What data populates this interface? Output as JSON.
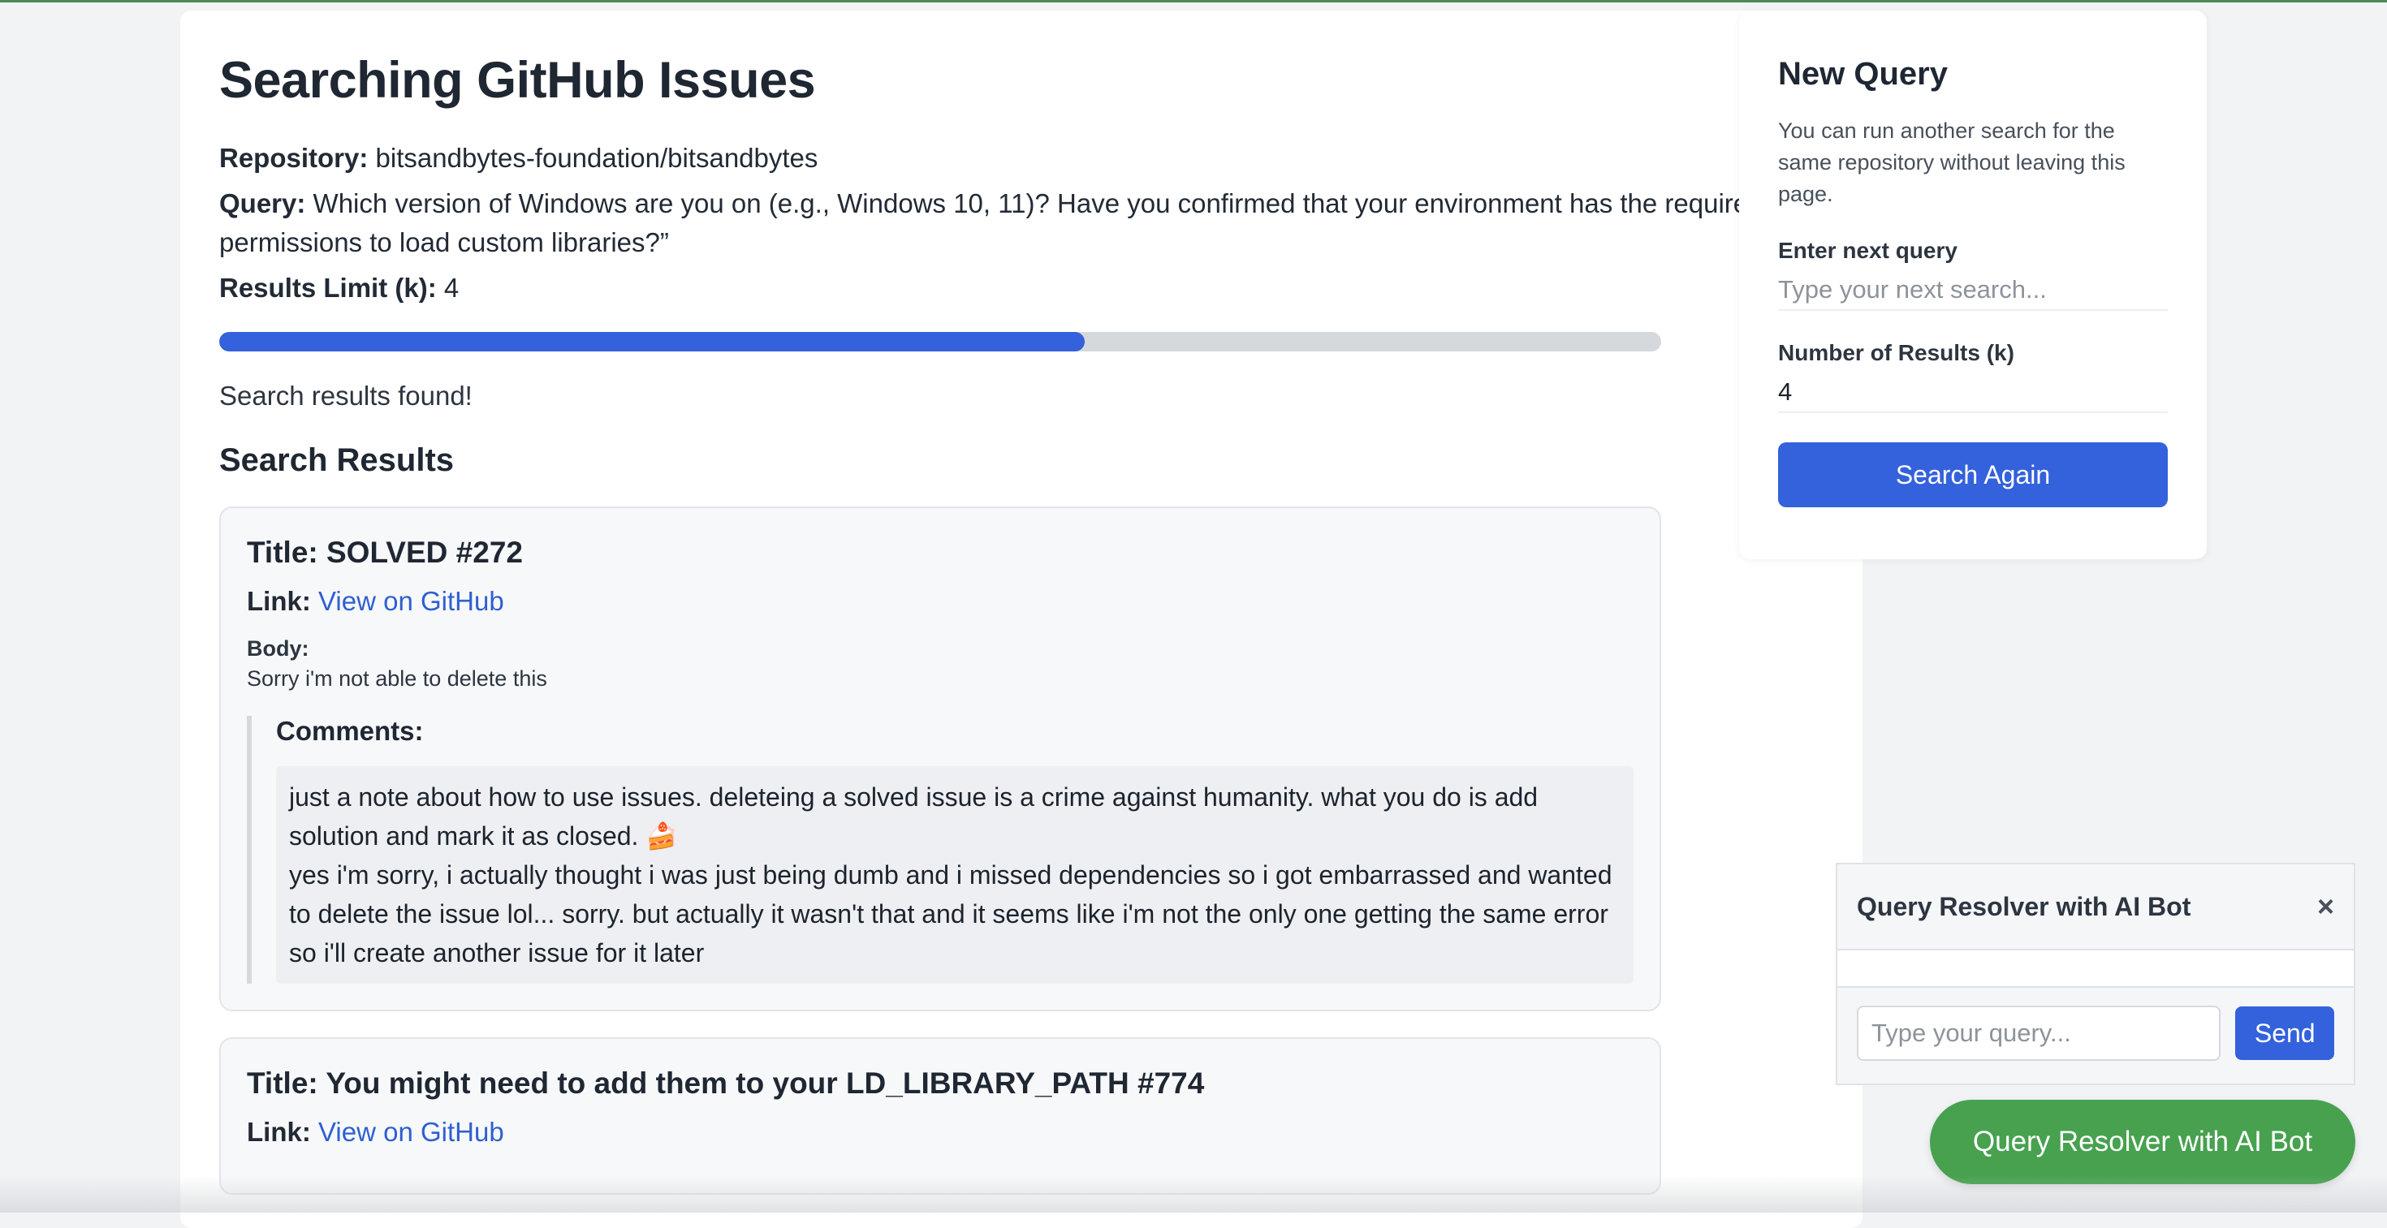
{
  "main": {
    "title": "Searching GitHub Issues",
    "repository_label": "Repository:",
    "repository_value": "bitsandbytes-foundation/bitsandbytes",
    "query_label": "Query:",
    "query_value": "Which version of Windows are you on (e.g., Windows 10, 11)? Have you confirmed that your environment has the required permissions to load custom libraries?”",
    "limit_label": "Results Limit (k):",
    "limit_value": "4",
    "progress_percent": 60,
    "status": "Search results found!",
    "results_heading": "Search Results",
    "results": [
      {
        "title": "Title: SOLVED #272",
        "link_label": "Link:",
        "link_text": "View on GitHub",
        "body_label": "Body:",
        "body": "Sorry i'm not able to delete this",
        "comments_label": "Comments:",
        "comments": [
          "just a note about how to use issues. deleteing a solved issue is a crime against humanity. what you do is add solution and mark it as closed. 🍰",
          "yes i'm sorry, i actually thought i was just being dumb and i missed dependencies so i got embarrassed and wanted to delete the issue lol... sorry. but actually it wasn't that and it seems like i'm not the only one getting the same error so i'll create another issue for it later"
        ]
      },
      {
        "title": "Title: You might need to add them to your LD_LIBRARY_PATH #774",
        "link_label": "Link:",
        "link_text": "View on GitHub"
      }
    ]
  },
  "sidebar": {
    "title": "New Query",
    "description": "You can run another search for the same repository without leaving this page.",
    "next_query_label": "Enter next query",
    "next_query_placeholder": "Type your next search...",
    "next_query_value": "",
    "k_label": "Number of Results (k)",
    "k_value": "4",
    "search_button": "Search Again"
  },
  "chat": {
    "title": "Query Resolver with AI Bot",
    "close": "×",
    "input_placeholder": "Type your query...",
    "send_label": "Send",
    "fab_label": "Query Resolver with AI Bot"
  },
  "colors": {
    "accent": "#3461dc",
    "fab": "#47a14f",
    "link": "#2f5fd0"
  }
}
